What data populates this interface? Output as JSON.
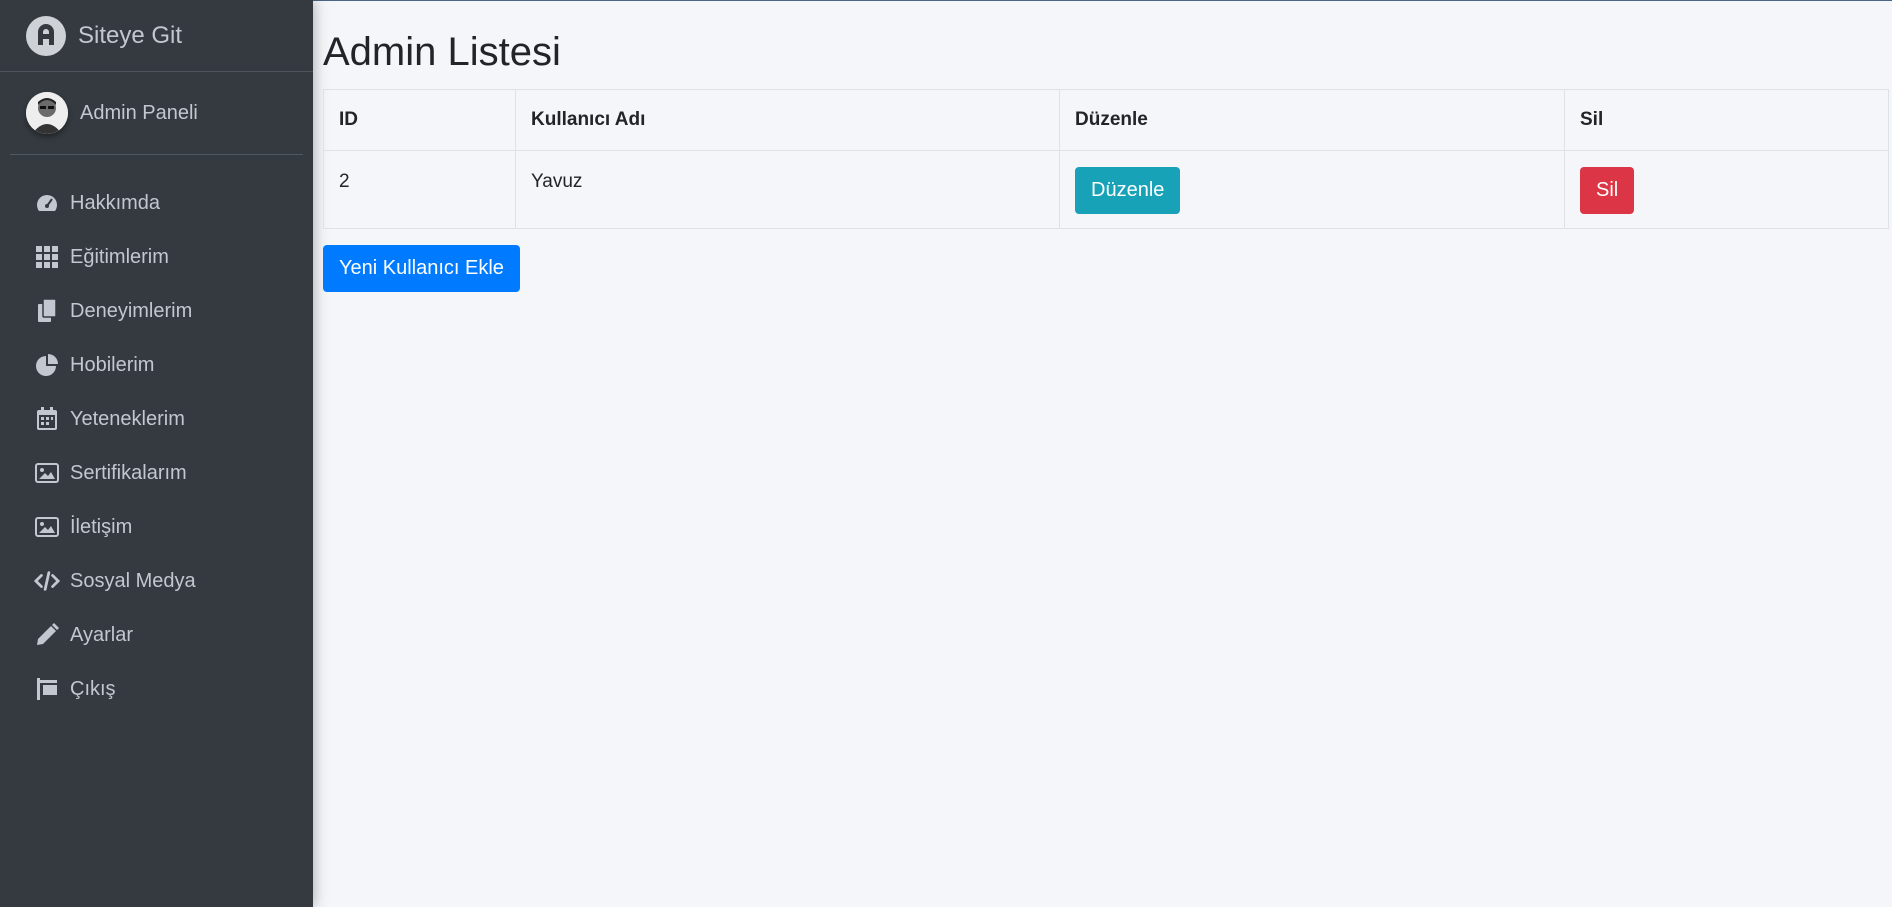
{
  "brand": {
    "title": "Siteye Git",
    "logo_icon": "rocket-letter-icon"
  },
  "user": {
    "name": "Admin Paneli"
  },
  "sidebar": {
    "items": [
      {
        "label": "Hakkımda",
        "icon": "dashboard-icon"
      },
      {
        "label": "Eğitimlerim",
        "icon": "grid-icon"
      },
      {
        "label": "Deneyimlerim",
        "icon": "copy-icon"
      },
      {
        "label": "Hobilerim",
        "icon": "pie-chart-icon"
      },
      {
        "label": "Yeteneklerim",
        "icon": "calendar-icon"
      },
      {
        "label": "Sertifikalarım",
        "icon": "image-icon"
      },
      {
        "label": "İletişim",
        "icon": "image-icon"
      },
      {
        "label": "Sosyal Medya",
        "icon": "code-icon"
      },
      {
        "label": "Ayarlar",
        "icon": "pencil-icon"
      },
      {
        "label": "Çıkış",
        "icon": "sign-icon"
      }
    ]
  },
  "main": {
    "title": "Admin Listesi",
    "table": {
      "headers": [
        "ID",
        "Kullanıcı Adı",
        "Düzenle",
        "Sil"
      ],
      "rows": [
        {
          "id": "2",
          "username": "Yavuz",
          "edit_label": "Düzenle",
          "delete_label": "Sil"
        }
      ]
    },
    "add_button": "Yeni Kullanıcı Ekle"
  },
  "colors": {
    "sidebar_bg": "#343a40",
    "page_bg": "#f4f6f9",
    "info": "#17a2b8",
    "danger": "#dc3545",
    "primary": "#007bff"
  }
}
